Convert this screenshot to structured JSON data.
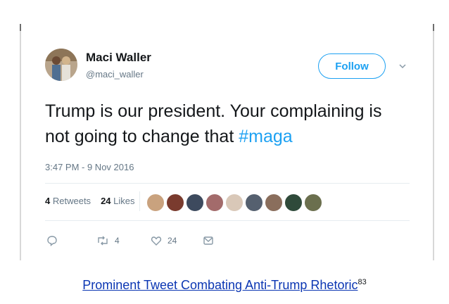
{
  "tweet": {
    "author_name": "Maci Waller",
    "author_handle": "@maci_waller",
    "follow_label": "Follow",
    "text_main": "Trump is our president. Your complaining is not going to change that ",
    "hashtag": "#maga",
    "timestamp": "3:47 PM - 9 Nov 2016",
    "retweets_count": "4",
    "retweets_label": "Retweets",
    "likes_count": "24",
    "likes_label": "Likes",
    "action_retweet_count": "4",
    "action_like_count": "24"
  },
  "caption": {
    "text": "Prominent Tweet Combating Anti-Trump Rhetoric",
    "footnote": "83"
  },
  "colors": {
    "brand_blue": "#1da1f2",
    "link_blue": "#0b36b3",
    "text_dark": "#14171a",
    "text_muted": "#657786"
  },
  "icons": [
    "avatar-photo",
    "chevron-down-icon",
    "reply-icon",
    "retweet-icon",
    "heart-icon",
    "message-icon"
  ]
}
